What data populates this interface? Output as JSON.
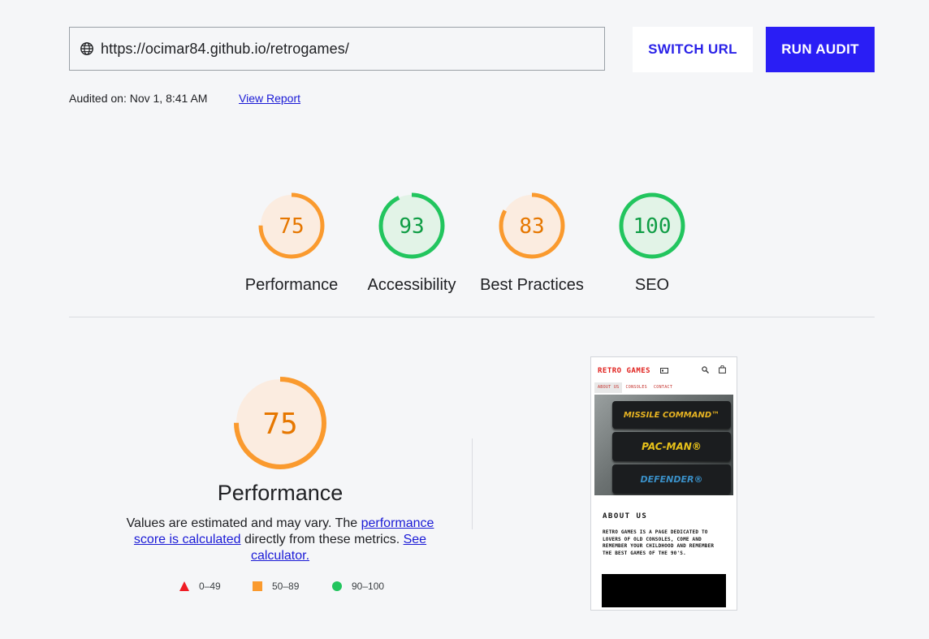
{
  "url_bar": {
    "value": "https://ocimar84.github.io/retrogames/",
    "icon": "globe-icon"
  },
  "buttons": {
    "switch_url": "SWITCH URL",
    "run_audit": "RUN AUDIT"
  },
  "audit_meta": {
    "audited_on": "Audited on: Nov 1, 8:41 AM",
    "view_report": "View Report"
  },
  "scores": [
    {
      "label": "Performance",
      "value": "75",
      "color": "#fa9a2e",
      "fill": "#fbece0"
    },
    {
      "label": "Accessibility",
      "value": "93",
      "color": "#22c55e",
      "fill": "#e2f3e7"
    },
    {
      "label": "Best Practices",
      "value": "83",
      "color": "#fa9a2e",
      "fill": "#fbece0"
    },
    {
      "label": "SEO",
      "value": "100",
      "color": "#22c55e",
      "fill": "#e2f3e7"
    }
  ],
  "detail": {
    "score": "75",
    "title": "Performance",
    "desc_prefix": "Values are estimated and may vary. The ",
    "desc_link1": "performance score is calculated",
    "desc_mid": " directly from these metrics. ",
    "desc_link2": "See calculator."
  },
  "legend": [
    {
      "range": "0–49",
      "shape": "triangle",
      "color": "#ef1c24"
    },
    {
      "range": "50–89",
      "shape": "square",
      "color": "#fa9a2e"
    },
    {
      "range": "90–100",
      "shape": "circle",
      "color": "#22c55e"
    }
  ],
  "preview": {
    "brand": "RETRO GAMES",
    "nav": [
      "ABOUT US",
      "CONSOLES",
      "CONTACT"
    ],
    "cartridges": [
      "MISSILE COMMAND™",
      "PAC-MAN®",
      "DEFENDER®"
    ],
    "about_title": "ABOUT US",
    "about_text": "RETRO GAMES IS A PAGE DEDICATED TO LOVERS OF OLD CONSOLES, COME AND REMEMBER YOUR CHILDHOOD AND REMEMBER THE BEST GAMES OF THE 90'S."
  }
}
